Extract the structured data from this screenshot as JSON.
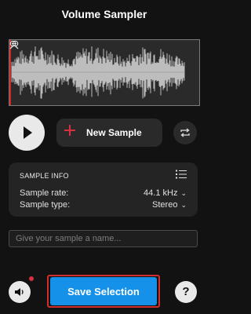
{
  "header": {
    "title": "Volume Sampler"
  },
  "waveform": {
    "zoom_out_icon": "zoom-out-icon",
    "zoom_in_icon": "zoom-in-icon"
  },
  "transport": {
    "play_icon": "play-icon",
    "new_sample_label": "New Sample",
    "new_sample_icon": "plus-icon",
    "loop_icon": "repeat-icon"
  },
  "sample_info": {
    "heading": "SAMPLE INFO",
    "menu_icon": "list-icon",
    "rate_label": "Sample rate:",
    "rate_value": "44.1 kHz",
    "type_label": "Sample type:",
    "type_value": "Stereo"
  },
  "name_input": {
    "placeholder": "Give your sample a name...",
    "value": ""
  },
  "footer": {
    "speaker_icon": "speaker-icon",
    "save_label": "Save Selection",
    "help_label": "?"
  },
  "colors": {
    "background": "#121212",
    "panel": "#2a2a2a",
    "accent_blue": "#1591ea",
    "accent_red": "#d12e2e",
    "waveform": "#bdbdbd"
  }
}
